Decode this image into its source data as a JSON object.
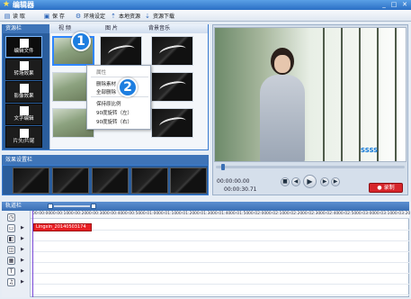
{
  "app": {
    "title": "编辑器"
  },
  "window": {
    "min": "_",
    "max": "□",
    "close": "✕"
  },
  "toolbar": {
    "items": [
      {
        "label": "读 取",
        "icon": "folder-open-icon"
      },
      {
        "label": "保 存",
        "icon": "save-icon"
      },
      {
        "label": "环境设定",
        "icon": "settings-icon"
      },
      {
        "label": "本地资源",
        "icon": "import-icon"
      },
      {
        "label": "资源下载",
        "icon": "download-icon"
      }
    ]
  },
  "left_panel": {
    "header": "资源栏",
    "tabs": [
      "视 频",
      "图 片",
      "背景音乐"
    ],
    "side_items": [
      "编辑文件",
      "转场效果",
      "影像效果",
      "文字编辑",
      "片头/片尾"
    ]
  },
  "context_menu": {
    "items": [
      "属性",
      "删除素材",
      "全部删除",
      "保持原比例",
      "90度旋转（左）",
      "90度旋转（右）"
    ]
  },
  "badges": {
    "one": "1",
    "two": "2"
  },
  "effects": {
    "header": "效果设置栏"
  },
  "preview": {
    "time_current": "00:00:00.00",
    "time_total": "00:00:30.71",
    "rec_label": "录制",
    "progress": 0.03,
    "watermark": "SSSS"
  },
  "timeline": {
    "label": "轨道栏",
    "ticks": [
      "00:00:00",
      "00:00:10",
      "00:00:20",
      "00:00:30",
      "00:00:40",
      "00:00:50",
      "00:01:00",
      "00:01:10",
      "00:01:20",
      "00:01:30",
      "00:01:40",
      "00:01:50",
      "00:02:00",
      "00:02:10",
      "00:02:20",
      "00:02:30",
      "00:02:40",
      "00:02:50",
      "00:03:00",
      "00:03:10",
      "00:03:20"
    ],
    "clip_name": "Lingxin_20140503174"
  },
  "colors": {
    "accent": "#2b6fc4",
    "clip": "#e81e23",
    "record": "#d7262b"
  }
}
